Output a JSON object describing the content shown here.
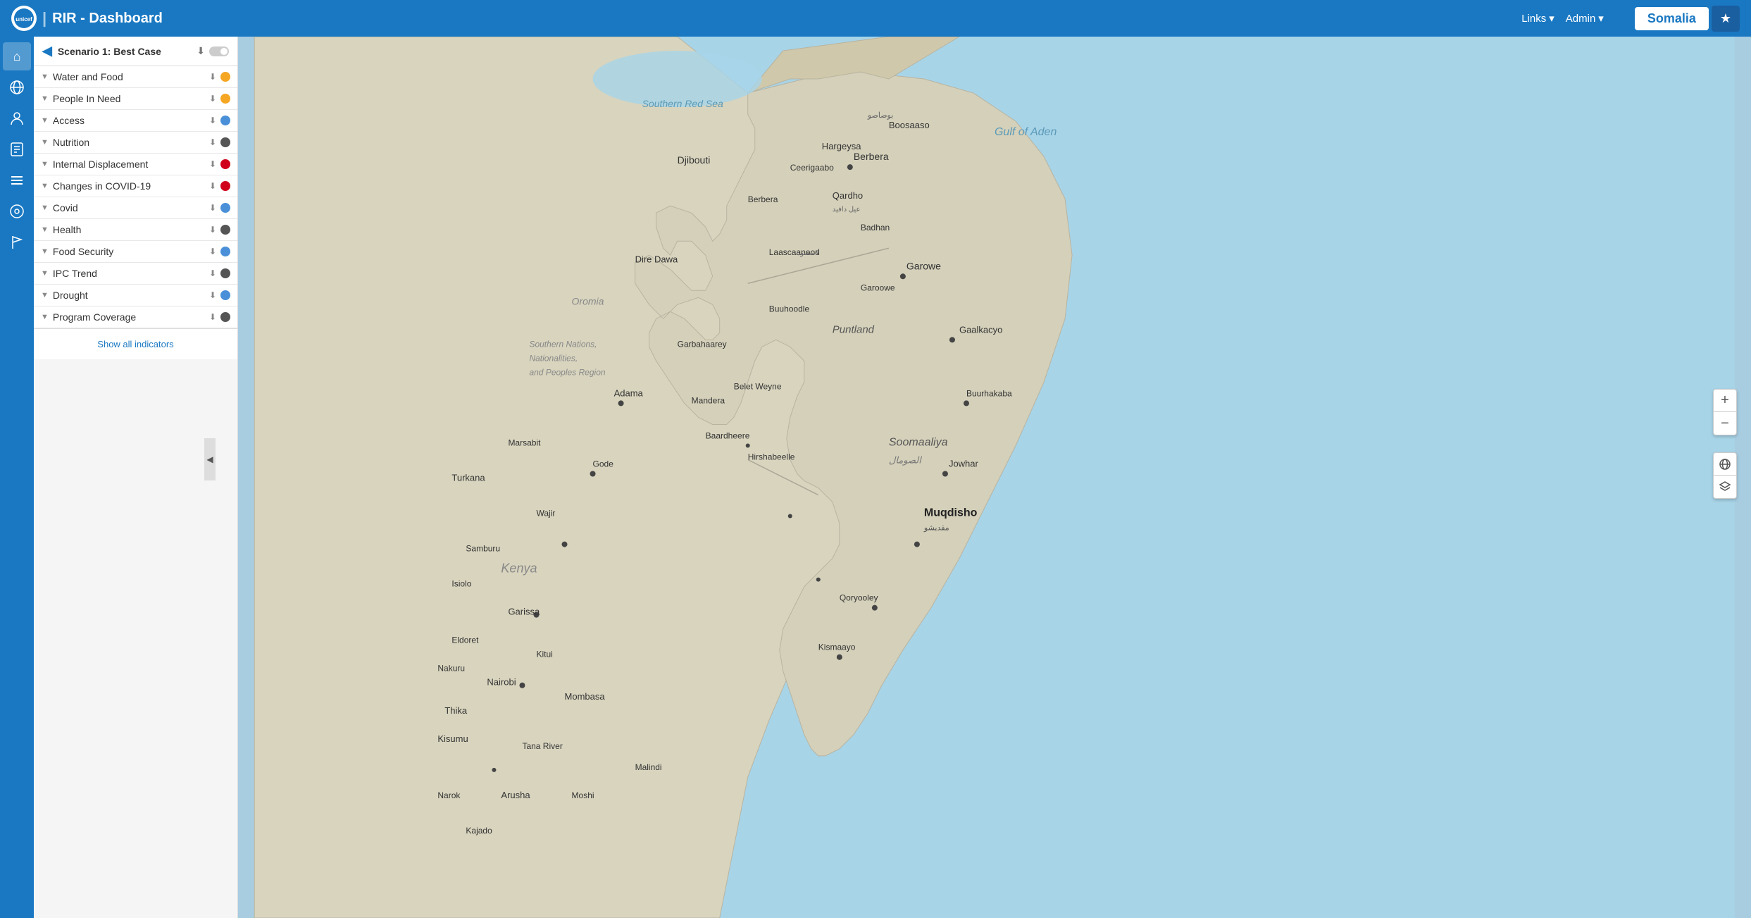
{
  "app": {
    "title": "RIR - Dashboard",
    "logo_text": "unicef",
    "separator": "|"
  },
  "nav": {
    "links_label": "Links",
    "admin_label": "Admin",
    "country": "Somalia",
    "star_icon": "★"
  },
  "sidebar": {
    "scenario_label": "Scenario 1: Best Case",
    "show_all_label": "Show all indicators",
    "layers": [
      {
        "name": "Water and Food",
        "dot_color": "orange"
      },
      {
        "name": "People In Need",
        "dot_color": "orange"
      },
      {
        "name": "Access",
        "dot_color": "blue"
      },
      {
        "name": "Nutrition",
        "dot_color": "dark"
      },
      {
        "name": "Internal Displacement",
        "dot_color": "red"
      },
      {
        "name": "Changes in COVID-19",
        "dot_color": "red"
      },
      {
        "name": "Covid",
        "dot_color": "blue"
      },
      {
        "name": "Health",
        "dot_color": "dark"
      },
      {
        "name": "Food Security",
        "dot_color": "blue"
      },
      {
        "name": "IPC Trend",
        "dot_color": "dark"
      },
      {
        "name": "Drought",
        "dot_color": "blue"
      },
      {
        "name": "Program Coverage",
        "dot_color": "dark"
      }
    ]
  },
  "icon_bar": {
    "icons": [
      {
        "name": "home-icon",
        "symbol": "⌂",
        "active": true
      },
      {
        "name": "globe-icon",
        "symbol": "🌐",
        "active": false
      },
      {
        "name": "person-icon",
        "symbol": "👤",
        "active": false
      },
      {
        "name": "flag-icon",
        "symbol": "⚑",
        "active": false
      },
      {
        "name": "list-icon",
        "symbol": "☰",
        "active": false
      },
      {
        "name": "earth-icon",
        "symbol": "◎",
        "active": false
      },
      {
        "name": "bookmark-icon",
        "symbol": "⚑",
        "active": false
      }
    ]
  },
  "map": {
    "background_ocean": "#a8d4e8",
    "background_land": "#e8ead8"
  }
}
